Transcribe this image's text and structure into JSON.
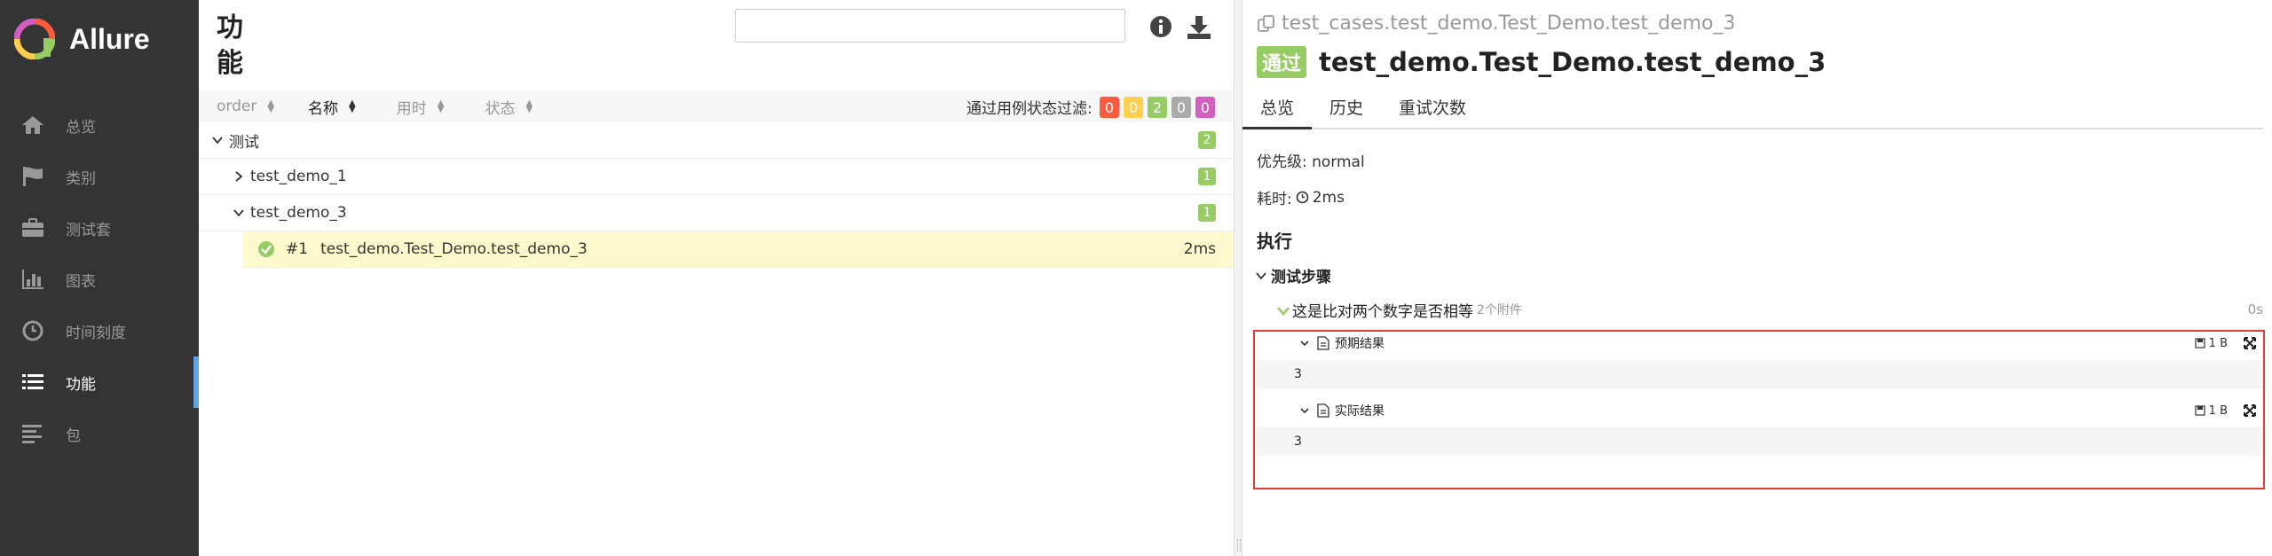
{
  "sidebar": {
    "brand": "Allure",
    "items": [
      {
        "label": "总览",
        "icon": "home-icon"
      },
      {
        "label": "类别",
        "icon": "flag-icon"
      },
      {
        "label": "测试套",
        "icon": "briefcase-icon"
      },
      {
        "label": "图表",
        "icon": "bar-chart-icon"
      },
      {
        "label": "时间刻度",
        "icon": "clock-icon"
      },
      {
        "label": "功能",
        "icon": "list-icon"
      },
      {
        "label": "包",
        "icon": "align-left-icon"
      }
    ],
    "active_index": 5
  },
  "tree_panel": {
    "title": "功能",
    "search": {
      "value": "",
      "placeholder": ""
    },
    "sort": [
      {
        "label": "order"
      },
      {
        "label": "名称"
      },
      {
        "label": "用时"
      },
      {
        "label": "状态"
      }
    ],
    "filter_label": "通过用例状态过滤:",
    "status_counts": [
      {
        "value": "0",
        "color": "#fd5a3e"
      },
      {
        "value": "0",
        "color": "#ffd050"
      },
      {
        "value": "2",
        "color": "#97cc64"
      },
      {
        "value": "0",
        "color": "#aaaaaa"
      },
      {
        "value": "0",
        "color": "#d35ebe"
      }
    ],
    "tree": {
      "group": {
        "name": "测试",
        "count": "2"
      },
      "children": [
        {
          "name": "test_demo_1",
          "count": "1",
          "expanded": false
        },
        {
          "name": "test_demo_3",
          "count": "1",
          "expanded": true
        }
      ],
      "leaf": {
        "num": "#1",
        "name": "test_demo.Test_Demo.test_demo_3",
        "duration": "2ms"
      }
    }
  },
  "detail": {
    "breadcrumb": "test_cases.test_demo.Test_Demo.test_demo_3",
    "status": "通过",
    "title": "test_demo.Test_Demo.test_demo_3",
    "tabs": [
      "总览",
      "历史",
      "重试次数"
    ],
    "severity": "优先级: normal",
    "duration_label": "耗时:",
    "duration_value": "2ms",
    "execution_title": "执行",
    "steps_title": "测试步骤",
    "step": {
      "name": "这是比对两个数字是否相等",
      "attachments": "2个附件",
      "time": "0s"
    },
    "attachments": [
      {
        "name": "预期结果",
        "size": "1 B",
        "content": "3"
      },
      {
        "name": "实际结果",
        "size": "1 B",
        "content": "3"
      }
    ]
  }
}
